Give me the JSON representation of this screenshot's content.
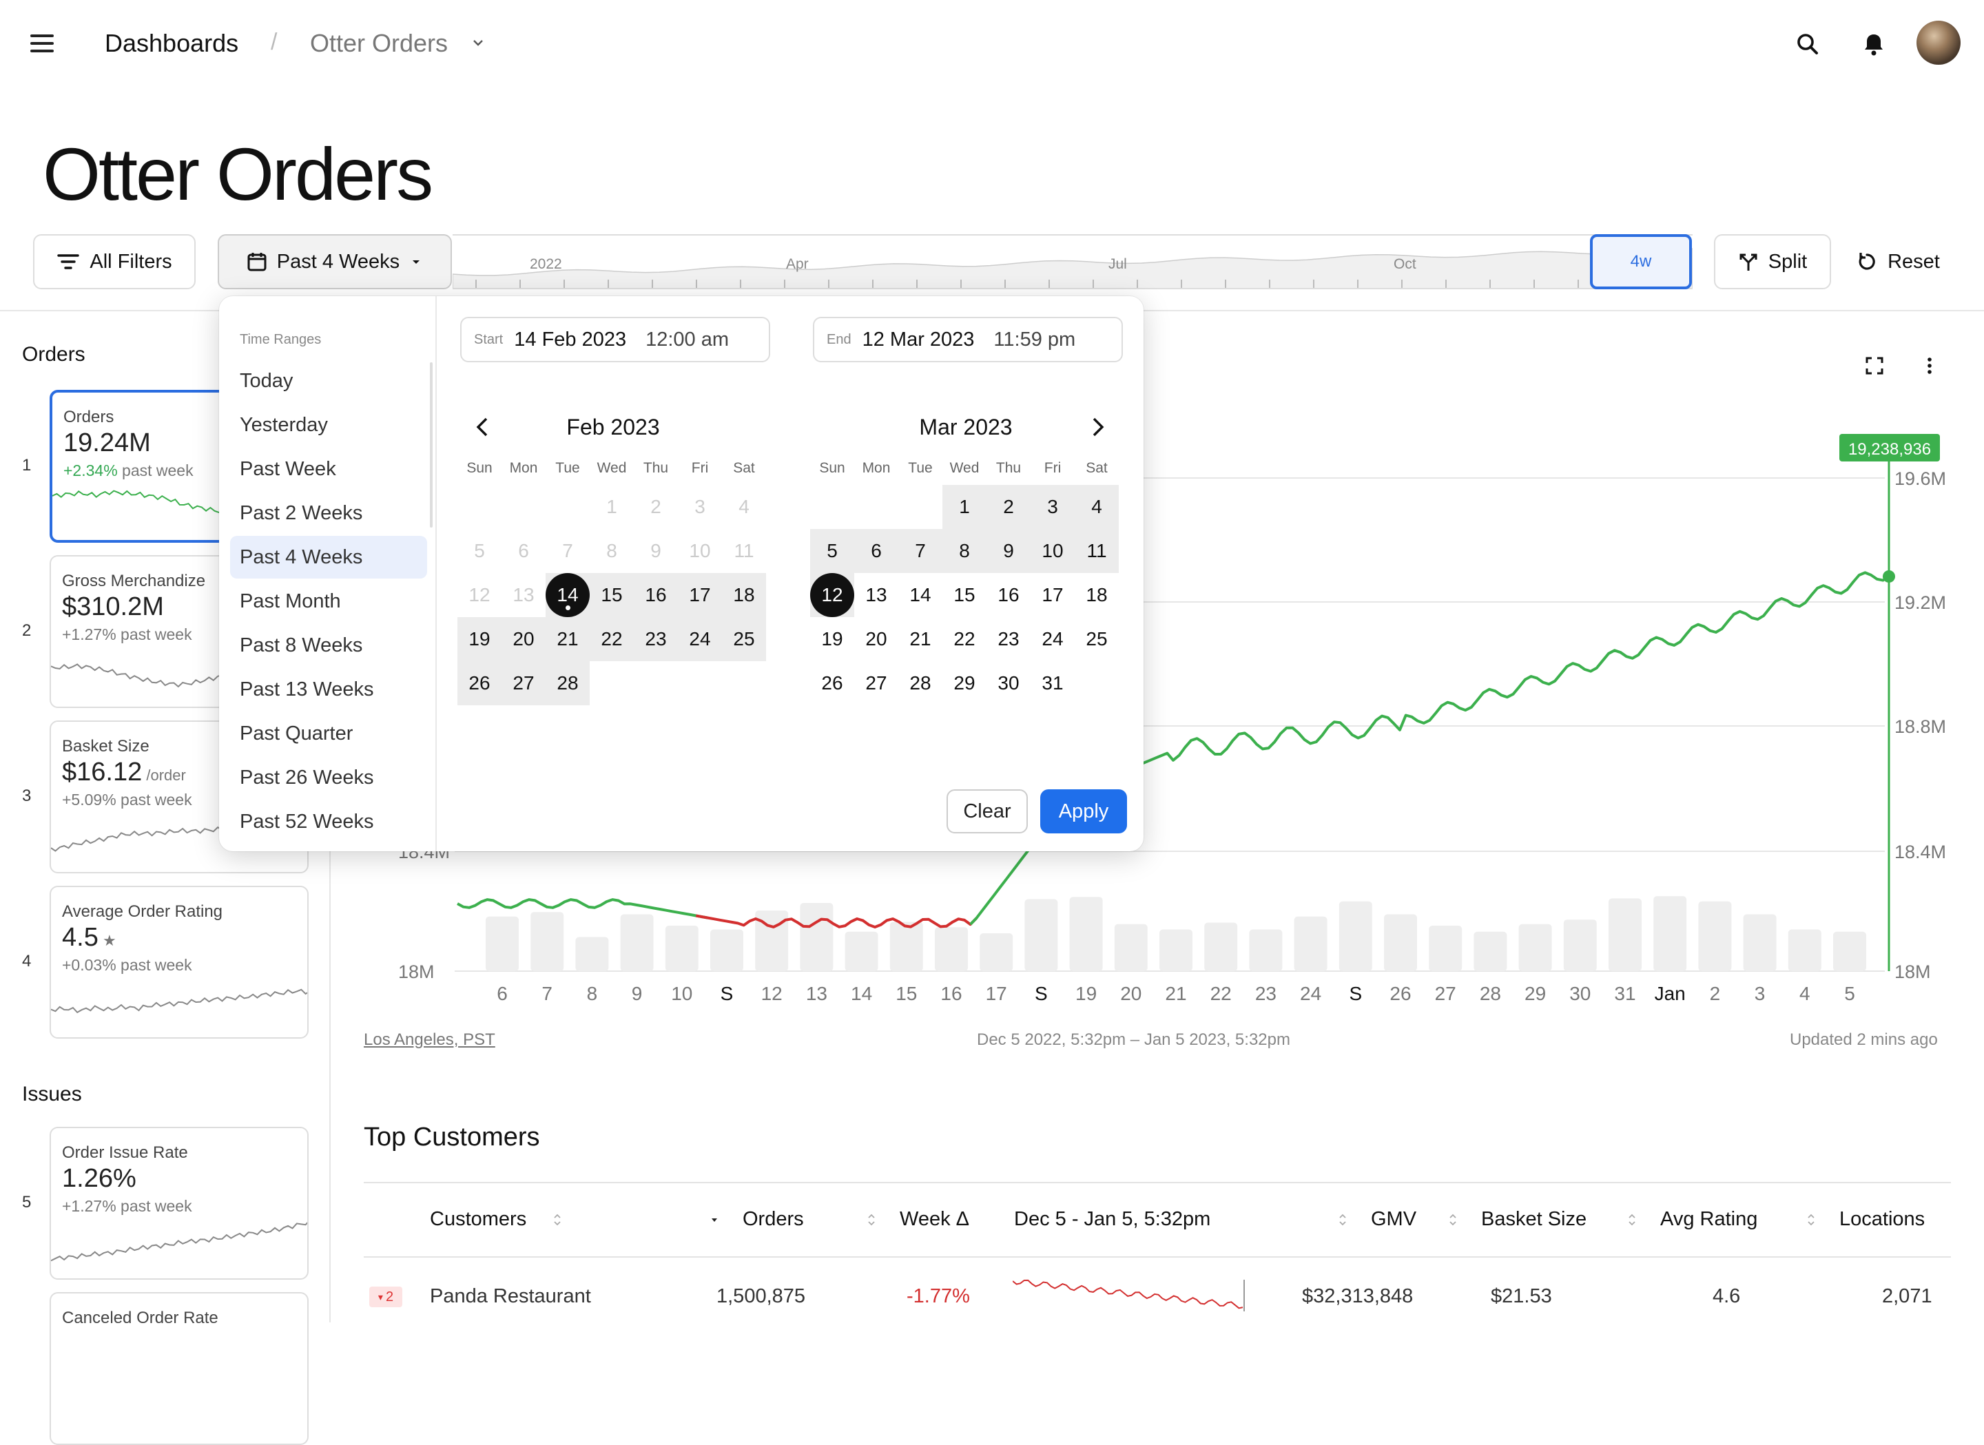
{
  "header": {
    "breadcrumb_root": "Dashboards",
    "breadcrumb_separator": "/",
    "breadcrumb_current": "Otter Orders"
  },
  "page_title": "Otter Orders",
  "toolbar": {
    "filters_label": "All Filters",
    "range_label": "Past 4 Weeks",
    "timeline_labels": [
      "2022",
      "Apr",
      "Jul",
      "Oct"
    ],
    "timeline_window_label": "4w",
    "split_label": "Split",
    "reset_label": "Reset"
  },
  "sidebar": {
    "orders_heading": "Orders",
    "issues_heading": "Issues",
    "cards": [
      {
        "num": "1",
        "title": "Orders",
        "value": "19.24M",
        "unit": "",
        "delta": "+2.34%",
        "delta_suffix": " past week",
        "delta_color": "#34a853"
      },
      {
        "num": "2",
        "title": "Gross Merchandize",
        "value": "$310.2M",
        "unit": "",
        "delta": "+1.27%",
        "delta_suffix": " past week",
        "delta_color": "#777777"
      },
      {
        "num": "3",
        "title": "Basket Size",
        "value": "$16.12",
        "unit": "/order",
        "delta": "+5.09%",
        "delta_suffix": " past week",
        "delta_color": "#777777"
      },
      {
        "num": "4",
        "title": "Average Order Rating",
        "value": "4.5",
        "unit": "★",
        "delta": "+0.03%",
        "delta_suffix": " past week",
        "delta_color": "#777777"
      },
      {
        "num": "5",
        "title": "Order Issue Rate",
        "value": "1.26%",
        "unit": "",
        "delta": "+1.27%",
        "delta_suffix": " past week",
        "delta_color": "#777777"
      },
      {
        "num": "",
        "title": "Canceled Order Rate",
        "value": "",
        "unit": "",
        "delta": "",
        "delta_suffix": "",
        "delta_color": "#777777"
      }
    ]
  },
  "chart_data": {
    "type": "line",
    "title": "",
    "y_ticks": [
      "18M",
      "18.4M",
      "18.8M",
      "19.2M",
      "19.6M"
    ],
    "ylim": [
      18000000,
      19600000
    ],
    "highlight_value": "19,238,936",
    "x_tick_labels": [
      "6",
      "7",
      "8",
      "9",
      "10",
      "S",
      "12",
      "13",
      "14",
      "15",
      "16",
      "17",
      "S",
      "19",
      "20",
      "21",
      "22",
      "23",
      "24",
      "S",
      "26",
      "27",
      "28",
      "29",
      "30",
      "31",
      "Jan",
      "2",
      "3",
      "4",
      "5"
    ],
    "bold_ticks": [
      "S",
      "Jan"
    ],
    "series_color": "#3cb04d",
    "highlight_color": "#d32f2f",
    "bar_heights_relative": [
      0.72,
      0.78,
      0.45,
      0.75,
      0.6,
      0.55,
      0.8,
      0.9,
      0.52,
      0.65,
      0.58,
      0.5,
      0.95,
      0.98,
      0.62,
      0.55,
      0.64,
      0.55,
      0.72,
      0.92,
      0.75,
      0.6,
      0.52,
      0.62,
      0.68,
      0.96,
      0.99,
      0.92,
      0.75,
      0.55,
      0.52
    ]
  },
  "chart_footer": {
    "timezone": "Los Angeles, PST",
    "range": "Dec 5 2022, 5:32pm – Jan 5 2023, 5:32pm",
    "updated": "Updated 2 mins ago"
  },
  "table": {
    "title": "Top Customers",
    "headers": [
      "Customers",
      "Orders",
      "Week Δ",
      "Dec 5 - Jan 5, 5:32pm",
      "GMV",
      "Basket Size",
      "Avg Rating",
      "Locations"
    ],
    "row": {
      "rank": "2",
      "customer": "Panda Restaurant",
      "orders": "1,500,875",
      "week_delta": "-1.77%",
      "gmv": "$32,313,848",
      "basket": "$21.53",
      "rating": "4.6",
      "locations": "2,071"
    }
  },
  "popover": {
    "heading": "Time Ranges",
    "ranges": [
      "Today",
      "Yesterday",
      "Past Week",
      "Past 2 Weeks",
      "Past 4 Weeks",
      "Past Month",
      "Past 8 Weeks",
      "Past 13 Weeks",
      "Past Quarter",
      "Past 26 Weeks",
      "Past 52 Weeks"
    ],
    "selected_range": "Past 4 Weeks",
    "start_label": "Start",
    "start_date": "14 Feb 2023",
    "start_time": "12:00 am",
    "end_label": "End",
    "end_date": "12 Mar 2023",
    "end_time": "11:59 pm",
    "weekdays": [
      "Sun",
      "Mon",
      "Tue",
      "Wed",
      "Thu",
      "Fri",
      "Sat"
    ],
    "month1": "Feb 2023",
    "month2": "Mar 2023",
    "clear_label": "Clear",
    "apply_label": "Apply"
  }
}
